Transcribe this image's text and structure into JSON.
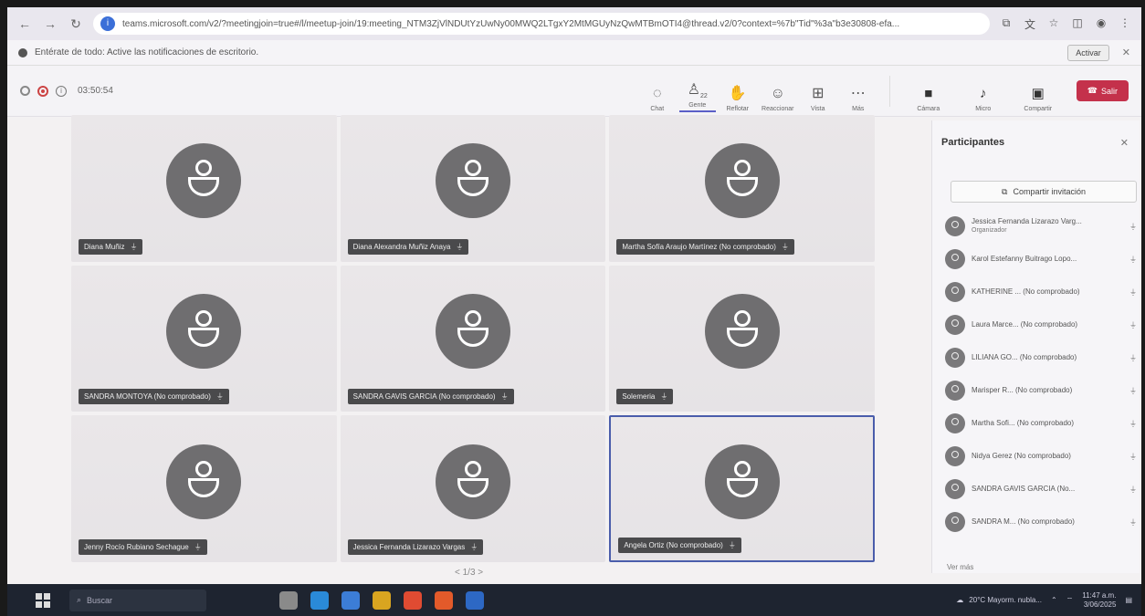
{
  "browser": {
    "url": "teams.microsoft.com/v2/?meetingjoin=true#/l/meetup-join/19:meeting_NTM3ZjVlNDUtYzUwNy00MWQ2LTgxY2MtMGUyNzQwMTBmOTI4@thread.v2/0?context=%7b\"Tid\"%3a\"b3e30808-efa..."
  },
  "notification": {
    "text": "Entérate de todo: Active las notificaciones de escritorio.",
    "button": "Activar"
  },
  "toolbar": {
    "timer": "03:50:54",
    "buttons": [
      {
        "label": "Chat",
        "icon": "chat-icon",
        "glyph": "◌"
      },
      {
        "label": "Gente",
        "icon": "people-icon",
        "glyph": "♙",
        "badge": "22"
      },
      {
        "label": "Reflotar",
        "icon": "raise-hand-icon",
        "glyph": "✋"
      },
      {
        "label": "Reaccionar",
        "icon": "react-icon",
        "glyph": "☺"
      },
      {
        "label": "Vista",
        "icon": "view-icon",
        "glyph": "⊞"
      },
      {
        "label": "Más",
        "icon": "more-icon",
        "glyph": "⋯"
      }
    ],
    "media": [
      {
        "label": "Cámara",
        "icon": "camera-icon",
        "glyph": "■"
      },
      {
        "label": "Micro",
        "icon": "mic-icon",
        "glyph": "♪"
      },
      {
        "label": "Compartir",
        "icon": "share-icon",
        "glyph": "▣"
      }
    ],
    "leave": "Salir"
  },
  "tiles": [
    {
      "name": "Diana Muñiz"
    },
    {
      "name": "Diana Alexandra Muñiz Anaya"
    },
    {
      "name": "Martha Sofía Araujo Martínez (No comprobado)"
    },
    {
      "name": "SANDRA MONTOYA (No comprobado)"
    },
    {
      "name": "SANDRA GAVIS GARCIA (No comprobado)"
    },
    {
      "name": "Solemeria"
    },
    {
      "name": "Jenny Rocío Rubiano Sechague"
    },
    {
      "name": "Jessica Fernanda Lizarazo Vargas"
    },
    {
      "name": "Angela Ortiz (No comprobado)"
    }
  ],
  "pager": "< 1/3 >",
  "panel": {
    "title": "Participantes",
    "invite": "Compartir invitación",
    "participants": [
      {
        "name": "Jessica Fernanda Lizarazo Varg...",
        "role": "Organizador"
      },
      {
        "name": "Karol Estefanny Buitrago Lopo..."
      },
      {
        "name": "KATHERINE ... (No comprobado)"
      },
      {
        "name": "Laura Marce... (No comprobado)"
      },
      {
        "name": "LILIANA GO... (No comprobado)"
      },
      {
        "name": "Marisper R... (No comprobado)"
      },
      {
        "name": "Martha Sofi... (No comprobado)"
      },
      {
        "name": "Nidya Gerez (No comprobado)"
      },
      {
        "name": "SANDRA GAVIS GARCIA (No..."
      },
      {
        "name": "SANDRA M... (No comprobado)"
      }
    ],
    "see_more": "Ver más"
  },
  "taskbar": {
    "search": "Buscar",
    "weather": "20°C  Mayorm. nubla...",
    "time": "11:47 a.m.",
    "date": "3/06/2025",
    "app_colors": [
      "#8a8a8a",
      "#2a8ad8",
      "#3c7dd6",
      "#d9a520",
      "#e04b32",
      "#e35a2a",
      "#2d68c4"
    ]
  }
}
